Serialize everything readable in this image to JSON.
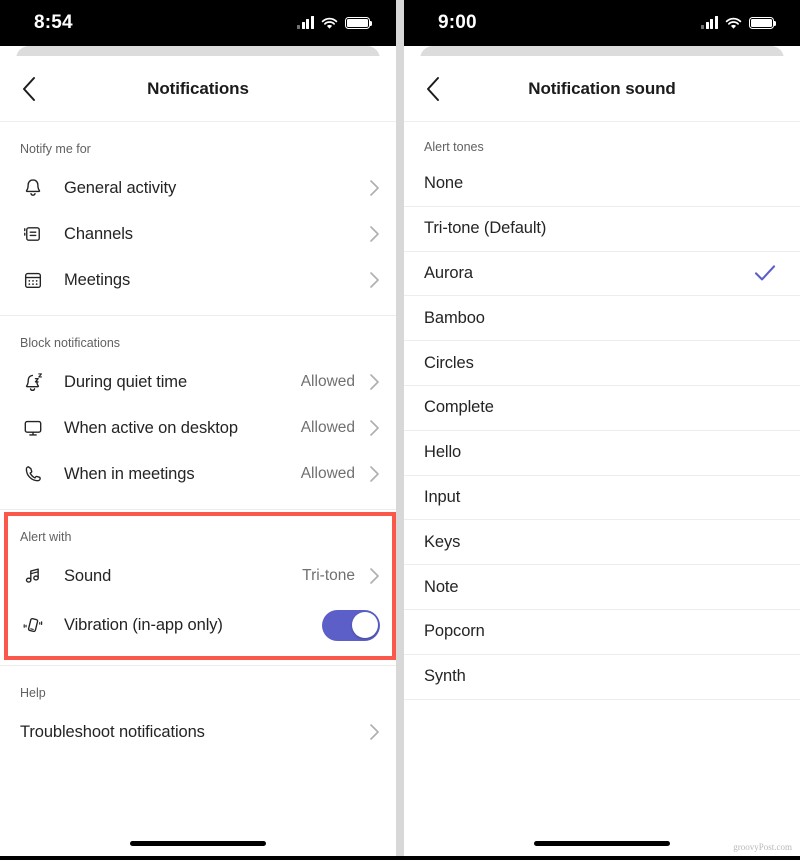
{
  "colors": {
    "accent_purple": "#5b5fc7",
    "highlight_red": "#f9584a",
    "text_primary": "#242424",
    "text_secondary": "#707070",
    "status_bar": "#000000"
  },
  "left_screen": {
    "status_bar": {
      "time": "8:54",
      "signal_icon": "cellular-bars-icon",
      "wifi_icon": "wifi-icon",
      "battery_icon": "battery-icon"
    },
    "nav": {
      "back_icon": "chevron-left-icon",
      "title": "Notifications"
    },
    "sections": [
      {
        "header": "Notify me for",
        "rows": [
          {
            "icon": "bell-icon",
            "label": "General activity",
            "value": "",
            "accessory": "chevron"
          },
          {
            "icon": "channels-icon",
            "label": "Channels",
            "value": "",
            "accessory": "chevron"
          },
          {
            "icon": "calendar-icon",
            "label": "Meetings",
            "value": "",
            "accessory": "chevron"
          }
        ]
      },
      {
        "header": "Block notifications",
        "rows": [
          {
            "icon": "bell-sleep-icon",
            "label": "During quiet time",
            "value": "Allowed",
            "accessory": "chevron"
          },
          {
            "icon": "monitor-icon",
            "label": "When active on desktop",
            "value": "Allowed",
            "accessory": "chevron"
          },
          {
            "icon": "phone-call-icon",
            "label": "When in meetings",
            "value": "Allowed",
            "accessory": "chevron"
          }
        ]
      },
      {
        "header": "Alert with",
        "highlighted": true,
        "rows": [
          {
            "icon": "music-note-icon",
            "label": "Sound",
            "value": "Tri-tone",
            "accessory": "chevron"
          },
          {
            "icon": "vibration-icon",
            "label": "Vibration (in-app only)",
            "value": "",
            "accessory": "toggle",
            "toggle_on": true
          }
        ]
      },
      {
        "header": "Help",
        "rows": [
          {
            "icon": "",
            "label": "Troubleshoot notifications",
            "value": "",
            "accessory": "chevron"
          }
        ]
      }
    ]
  },
  "right_screen": {
    "status_bar": {
      "time": "9:00",
      "signal_icon": "cellular-bars-icon",
      "wifi_icon": "wifi-icon",
      "battery_icon": "battery-icon"
    },
    "nav": {
      "back_icon": "chevron-left-icon",
      "title": "Notification sound"
    },
    "section_header": "Alert tones",
    "tones": [
      {
        "label": "None",
        "selected": false
      },
      {
        "label": "Tri-tone (Default)",
        "selected": false
      },
      {
        "label": "Aurora",
        "selected": true
      },
      {
        "label": "Bamboo",
        "selected": false
      },
      {
        "label": "Circles",
        "selected": false
      },
      {
        "label": "Complete",
        "selected": false
      },
      {
        "label": "Hello",
        "selected": false
      },
      {
        "label": "Input",
        "selected": false
      },
      {
        "label": "Keys",
        "selected": false
      },
      {
        "label": "Note",
        "selected": false
      },
      {
        "label": "Popcorn",
        "selected": false
      },
      {
        "label": "Synth",
        "selected": false
      }
    ]
  },
  "watermark": "groovyPost.com"
}
